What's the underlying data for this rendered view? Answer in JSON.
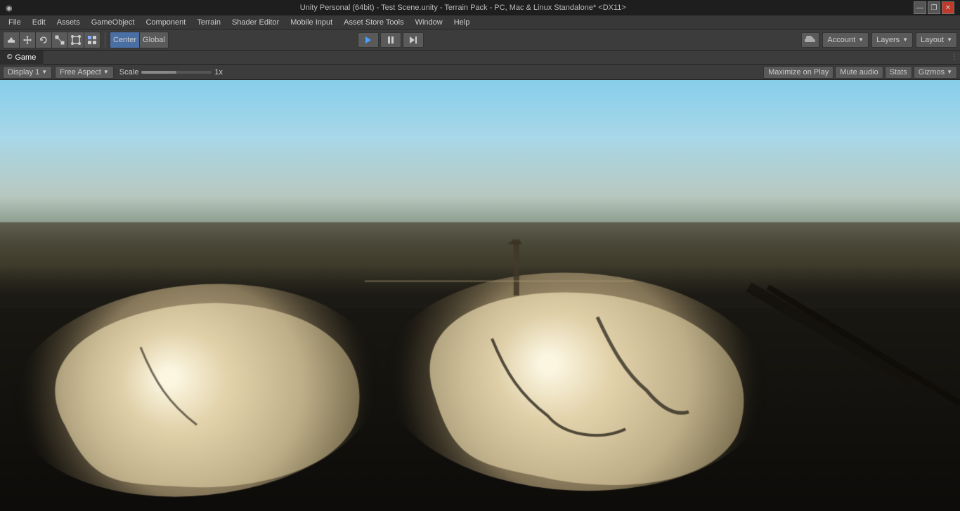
{
  "titlebar": {
    "logo": "◉",
    "title": "Unity Personal (64bit) - Test Scene.unity - Terrain Pack - PC, Mac & Linux Standalone* <DX11>",
    "minimize": "—",
    "maximize": "❐",
    "close": "✕"
  },
  "menubar": {
    "items": [
      {
        "label": "File",
        "id": "file"
      },
      {
        "label": "Edit",
        "id": "edit"
      },
      {
        "label": "Assets",
        "id": "assets"
      },
      {
        "label": "GameObject",
        "id": "gameobject"
      },
      {
        "label": "Component",
        "id": "component"
      },
      {
        "label": "Terrain",
        "id": "terrain"
      },
      {
        "label": "Shader Editor",
        "id": "shader-editor"
      },
      {
        "label": "Mobile Input",
        "id": "mobile-input"
      },
      {
        "label": "Asset Store Tools",
        "id": "asset-store-tools"
      },
      {
        "label": "Window",
        "id": "window"
      },
      {
        "label": "Help",
        "id": "help"
      }
    ]
  },
  "toolbar": {
    "hand_tool": "✋",
    "move_tool": "✜",
    "rotate_tool": "↺",
    "scale_tool": "⊡",
    "rect_tool": "⬚",
    "transform_tool": "⊞",
    "center_label": "Center",
    "global_label": "Global",
    "play_btn": "▶",
    "pause_btn": "⏸",
    "step_btn": "⏭",
    "cloud_icon": "☁",
    "account_label": "Account",
    "layers_label": "Layers",
    "layout_label": "Layout"
  },
  "game_panel": {
    "tab_label": "Game",
    "tab_icon": "©",
    "display_label": "Display 1",
    "aspect_label": "Free Aspect",
    "scale_label": "Scale",
    "scale_value": "1x",
    "maximize_on_play": "Maximize on Play",
    "mute_audio": "Mute audio",
    "stats": "Stats",
    "gizmos": "Gizmos"
  }
}
